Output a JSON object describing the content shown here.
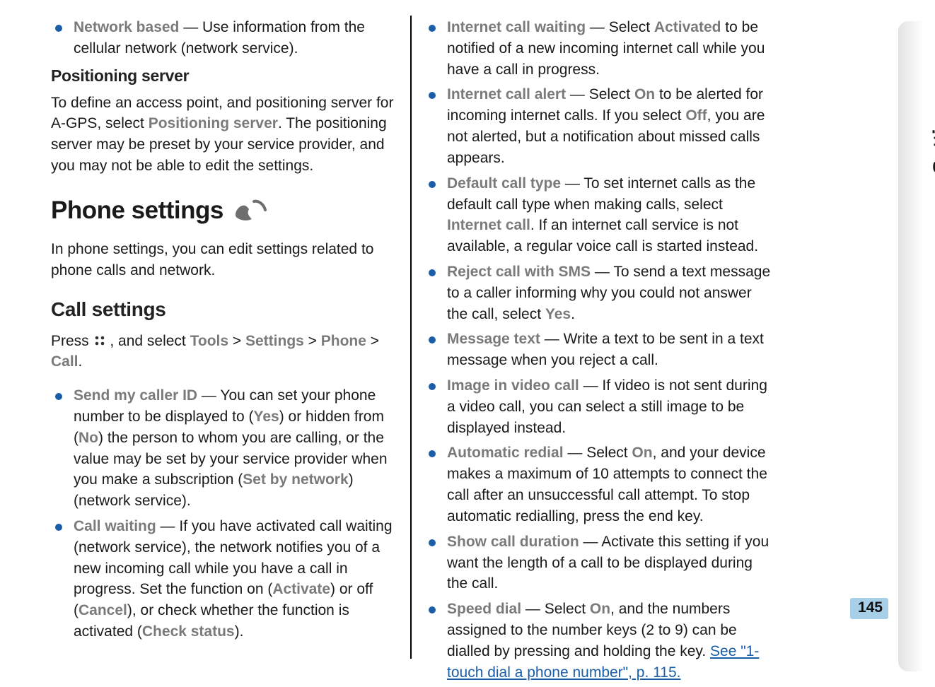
{
  "sidebar": {
    "label": "Settings",
    "page_number": "145"
  },
  "col_left": {
    "network_based": {
      "name": "Network based",
      "desc": "  — Use information from the cellular network (network service)."
    },
    "positioning_server_heading": "Positioning server",
    "positioning_server_para_pre": "To define an access point, and positioning server for A-GPS, select ",
    "positioning_server_opt": "Positioning server",
    "positioning_server_para_post": ". The positioning server may be preset by your service provider, and you may not be able to edit the settings.",
    "phone_settings_heading": "Phone settings",
    "phone_settings_para": "In phone settings, you can edit settings related to phone calls and network.",
    "call_settings_heading": "Call settings",
    "call_settings_press": "Press ",
    "call_settings_and_select": " , and select ",
    "nav_tools": "Tools",
    "nav_settings": "Settings",
    "nav_phone": "Phone",
    "nav_call": "Call",
    "gt": "  >  ",
    "period": ".",
    "send_caller_id": {
      "name": "Send my caller ID",
      "pre": "  — You can set your phone number to be displayed to (",
      "yes": "Yes",
      "mid1": ") or hidden from (",
      "no": "No",
      "mid2": ") the person to whom you are calling, or the value may be set by your service provider when you make a subscription (",
      "sbn": "Set by network",
      "post": ") (network service)."
    },
    "call_waiting": {
      "name": "Call waiting",
      "pre": "  — If you have activated call waiting (network service), the network notifies you of a new incoming call while you have a call in progress. Set the function on (",
      "activate": "Activate",
      "mid1": ") or off (",
      "cancel": "Cancel",
      "mid2": "), or check whether the function is activated (",
      "check": "Check status",
      "post": ")."
    }
  },
  "col_right": {
    "internet_call_waiting": {
      "name": "Internet call waiting",
      "pre": "  — Select ",
      "activated": "Activated",
      "post": " to be notified of a new incoming internet call while you have a call in progress."
    },
    "internet_call_alert": {
      "name": "Internet call alert",
      "pre": "  — Select ",
      "on": "On",
      "mid": " to be alerted for incoming internet calls. If you select ",
      "off": "Off",
      "post": ", you are not alerted, but a notification about missed calls appears."
    },
    "default_call_type": {
      "name": "Default call type",
      "pre": "  — To set internet calls as the default call type when making calls, select ",
      "internet_call": "Internet call",
      "post": ". If an internet call service is not available, a regular voice call is started instead."
    },
    "reject_sms": {
      "name": "Reject call with SMS",
      "pre": "  — To send a text message to a caller informing why you could not answer the call, select ",
      "yes": "Yes",
      "post": "."
    },
    "message_text": {
      "name": "Message text",
      "post": "  — Write a text to be sent in a text message when you reject a call."
    },
    "image_video": {
      "name": "Image in video call",
      "post": "  — If video is not sent during a video call, you can select a still image to be displayed instead."
    },
    "auto_redial": {
      "name": "Automatic redial",
      "pre": "  — Select ",
      "on": "On",
      "post": ", and your device makes a maximum of 10 attempts to connect the call after an unsuccessful call attempt. To stop automatic redialling, press the end key."
    },
    "show_duration": {
      "name": "Show call duration",
      "post": "  — Activate this setting if you want the length of a call to be displayed during the call."
    },
    "speed_dial": {
      "name": "Speed dial",
      "pre": "  — Select ",
      "on": "On",
      "post": ", and the numbers assigned to the number keys (2 to 9) can be dialled by pressing and holding the key. ",
      "link": "See \"1-touch dial a phone number\", p. 115."
    }
  }
}
